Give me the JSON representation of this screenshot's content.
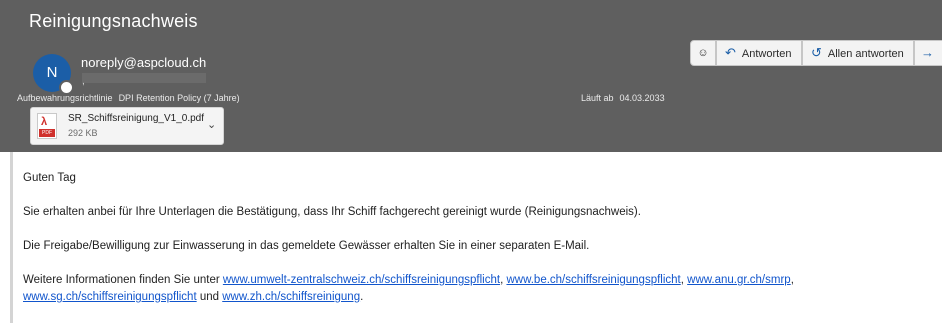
{
  "email": {
    "subject": "Reinigungsnachweis",
    "sender_initial": "N",
    "sender": "noreply@aspcloud.ch",
    "recipient_mark": ","
  },
  "toolbar": {
    "emoji_icon": "smiley-icon",
    "reply_label": "Antworten",
    "reply_all_label": "Allen antworten",
    "forward_icon": "arrow-right-icon"
  },
  "retention": {
    "label": "Aufbewahrungsrichtlinie",
    "value": "DPI Retention Policy (7 Jahre)",
    "expiry_label": "Läuft ab",
    "expiry_value": "04.03.2033"
  },
  "attachment": {
    "icon": "pdf-file-icon",
    "icon_tag": "PDF",
    "name": "SR_Schiffsreinigung_V1_0.pdf",
    "size": "292 KB"
  },
  "body": {
    "greeting": "Guten Tag",
    "line1": "Sie erhalten anbei für Ihre Unterlagen die Bestätigung, dass Ihr Schiff fachgerecht gereinigt wurde (Reinigungsnachweis).",
    "line2": "Die Freigabe/Bewilligung zur Einwasserung in das gemeldete Gewässer erhalten Sie in einer separaten E-Mail.",
    "line3_prefix": "Weitere Informationen finden Sie unter ",
    "links": [
      "www.umwelt-zentralschweiz.ch/schiffsreinigungspflicht",
      "www.be.ch/schiffsreinigungspflicht",
      "www.anu.gr.ch/smrp",
      "www.sg.ch/schiffsreinigungspflicht",
      "www.zh.ch/schiffsreinigung"
    ],
    "sep_comma": ", ",
    "sep_and": " und ",
    "end_period": "."
  },
  "colors": {
    "header_bg": "#5f5f5f",
    "avatar_bg": "#1b5ea7",
    "link": "#1155cc"
  }
}
